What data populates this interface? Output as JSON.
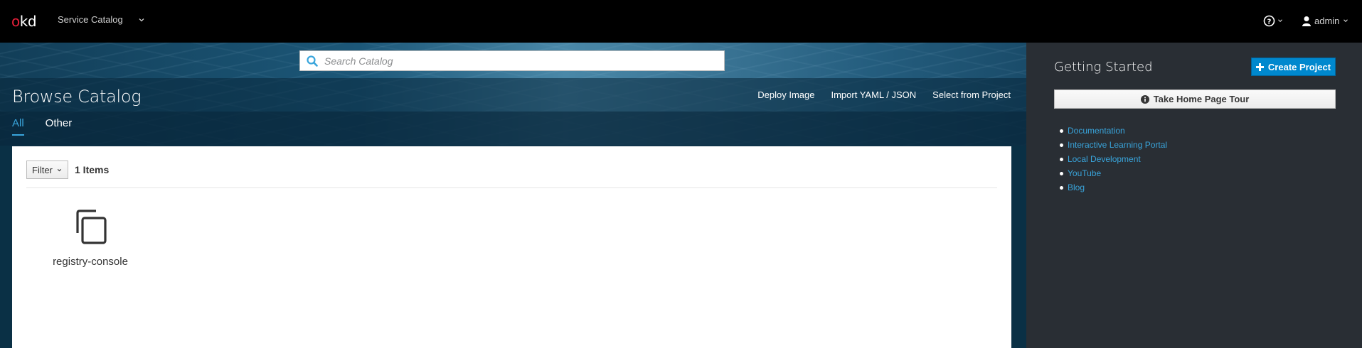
{
  "header": {
    "logo": {
      "o": "o",
      "kd": "kd"
    },
    "context_label": "Service Catalog",
    "user_name": "admin"
  },
  "search": {
    "placeholder": "Search Catalog"
  },
  "main": {
    "title": "Browse Catalog",
    "actions": [
      "Deploy Image",
      "Import YAML / JSON",
      "Select from Project"
    ],
    "tabs": [
      {
        "label": "All",
        "active": true
      },
      {
        "label": "Other",
        "active": false
      }
    ]
  },
  "catalog": {
    "filter_label": "Filter",
    "items_count": "1 Items",
    "items": [
      {
        "name": "registry-console",
        "icon": "copy-icon"
      }
    ]
  },
  "sidebar": {
    "title": "Getting Started",
    "create_project_label": "Create Project",
    "tour_label": "Take Home Page Tour",
    "links": [
      "Documentation",
      "Interactive Learning Portal",
      "Local Development",
      "YouTube",
      "Blog"
    ]
  },
  "colors": {
    "accent": "#39a5dc",
    "primary_button": "#0088ce",
    "topbar": "#000000",
    "sidebar": "#292e34",
    "brand_red": "#e8203a"
  }
}
